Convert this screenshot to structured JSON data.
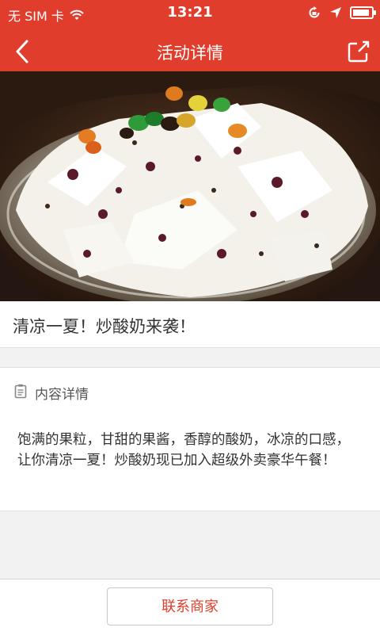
{
  "status_bar": {
    "carrier": "无 SIM 卡",
    "time": "13:21",
    "battery_level": 0.9,
    "icons": [
      "wifi-icon",
      "orientation-lock-icon",
      "location-arrow-icon",
      "battery-icon"
    ]
  },
  "nav": {
    "title": "活动详情",
    "back_icon": "chevron-left-icon",
    "share_icon": "share-icon"
  },
  "hero": {
    "image": "fried-yogurt-with-candies-photo"
  },
  "headline": "清凉一夏！炒酸奶来袭！",
  "details": {
    "icon": "document-icon",
    "section_title": "内容详情",
    "body": "饱满的果粒，甘甜的果酱，香醇的酸奶，冰凉的口感，让你清凉一夏！炒酸奶现已加入超级外卖豪华午餐！"
  },
  "footer": {
    "contact_label": "联系商家"
  },
  "colors": {
    "brand_red": "#e13d2c",
    "background": "#f2f2f2",
    "text": "#333333"
  }
}
